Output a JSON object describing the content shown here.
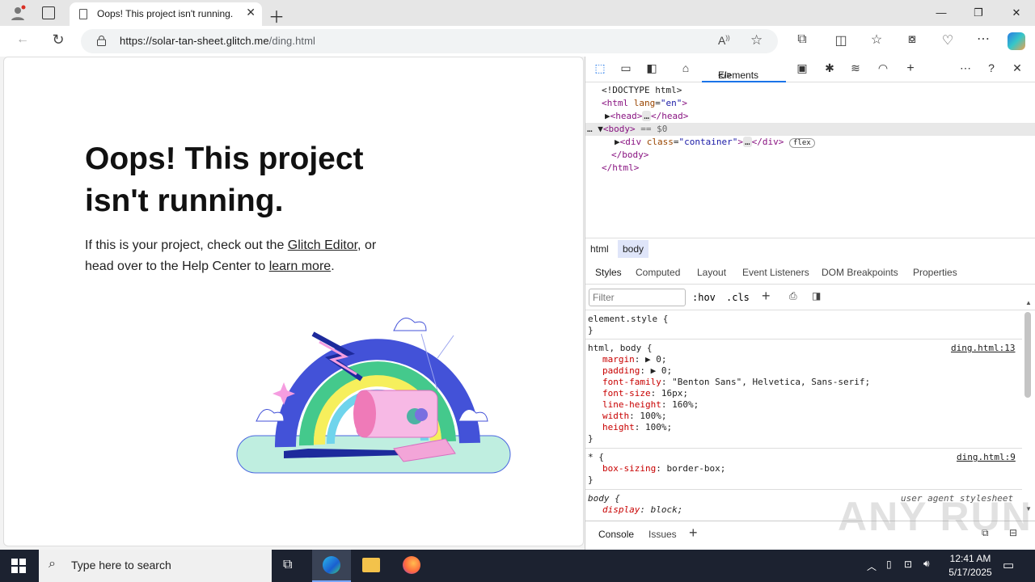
{
  "browser": {
    "tab_title": "Oops! This project isn't running.",
    "url_host": "https://solar-tan-sheet.glitch.me",
    "url_path": "/ding.html"
  },
  "page": {
    "heading": "Oops! This project isn't running.",
    "msg_part1": "If this is your project, check out the ",
    "link_editor": "Glitch Editor",
    "msg_part2": ", or head over to the Help Center to ",
    "link_learn": "learn more",
    "msg_part3": "."
  },
  "devtools": {
    "elements_tab": "Elements",
    "dom": {
      "doctype": "<!DOCTYPE html>",
      "html_open": "<html",
      "lang_attr": "lang",
      "lang_val": "\"en\"",
      "head": "<head>",
      "head_close": "</head>",
      "body": "<body>",
      "body_eq": "== $0",
      "div_open": "<div",
      "class_attr": "class",
      "class_val": "\"container\"",
      "div_close": "</div>",
      "flex_badge": "flex",
      "body_close": "</body>",
      "html_close": "</html>",
      "ellipsis": "…"
    },
    "breadcrumbs": [
      "html",
      "body"
    ],
    "subtabs": [
      "Styles",
      "Computed",
      "Layout",
      "Event Listeners",
      "DOM Breakpoints",
      "Properties"
    ],
    "filter_placeholder": "Filter",
    "hov": ":hov",
    "cls": ".cls",
    "rules": {
      "element_style": "element.style {",
      "close_brace": "}",
      "html_body_sel": "html, body {",
      "src1": "ding.html:13",
      "margin": "margin",
      "margin_val": "0;",
      "padding": "padding",
      "padding_val": "0;",
      "font_family": "font-family",
      "font_family_val": "\"Benton Sans\", Helvetica, Sans-serif;",
      "font_size": "font-size",
      "font_size_val": "16px;",
      "line_height": "line-height",
      "line_height_val": "160%;",
      "width": "width",
      "width_val": "100%;",
      "height": "height",
      "height_val": "100%;",
      "star_sel": "* {",
      "src2": "ding.html:9",
      "box_sizing": "box-sizing",
      "box_sizing_val": "border-box;",
      "body_sel": "body {",
      "src3": "user agent stylesheet",
      "display": "display",
      "display_val": "block;"
    },
    "drawer": {
      "console": "Console",
      "issues": "Issues"
    }
  },
  "taskbar": {
    "search_placeholder": "Type here to search",
    "time": "12:41 AM",
    "date": "5/17/2025"
  },
  "watermark": "ANY RUN"
}
